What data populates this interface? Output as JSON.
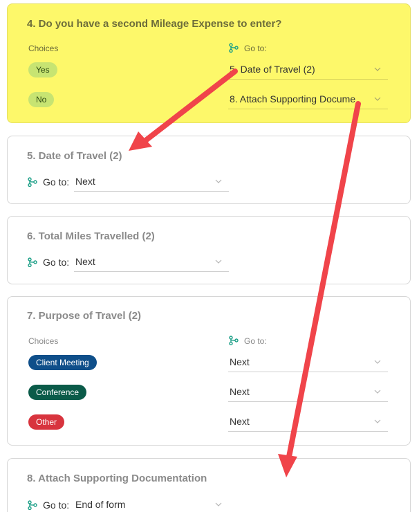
{
  "colors": {
    "highlight_bg": "#fdf86a",
    "branch_icon": "#1a9e86",
    "arrow": "#f0444a",
    "pill_yes": "#c7e472",
    "pill_no": "#c7e472",
    "pill_client": "#0f4f8a",
    "pill_conference": "#0b5b49",
    "pill_other": "#d8343e"
  },
  "icons": {
    "branch": "branch-icon",
    "chevron": "chevron-down-icon",
    "annotation": "red-arrow"
  },
  "q4": {
    "title": "4. Do you have a second Mileage Expense to enter?",
    "choices_label": "Choices",
    "goto_label": "Go to:",
    "rows": [
      {
        "choice": "Yes",
        "goto": "5. Date of Travel (2)"
      },
      {
        "choice": "No",
        "goto": "8. Attach Supporting Docume"
      }
    ]
  },
  "q5": {
    "title": "5. Date of Travel (2)",
    "goto_label": "Go to:",
    "goto_value": "Next"
  },
  "q6": {
    "title": "6. Total Miles Travelled (2)",
    "goto_label": "Go to:",
    "goto_value": "Next"
  },
  "q7": {
    "title": "7. Purpose of Travel (2)",
    "choices_label": "Choices",
    "goto_label": "Go to:",
    "rows": [
      {
        "choice": "Client Meeting",
        "goto": "Next"
      },
      {
        "choice": "Conference",
        "goto": "Next"
      },
      {
        "choice": "Other",
        "goto": "Next"
      }
    ]
  },
  "q8": {
    "title": "8. Attach Supporting Documentation",
    "goto_label": "Go to:",
    "goto_value": "End of form"
  }
}
